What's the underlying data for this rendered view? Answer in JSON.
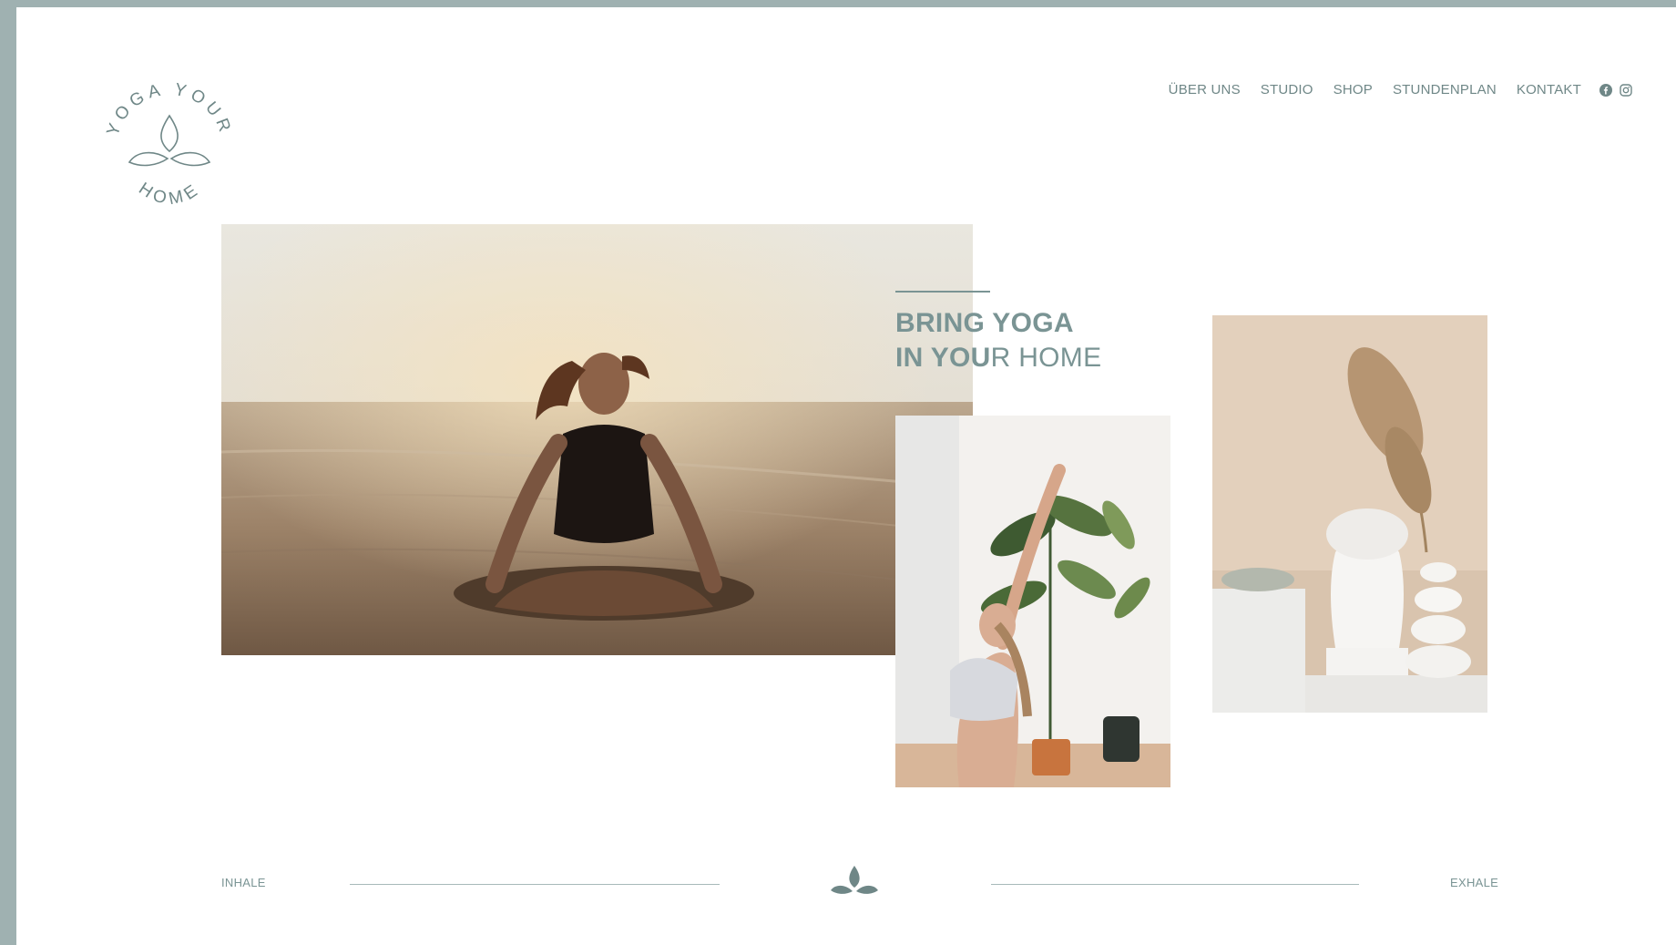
{
  "brand": {
    "logo_top": "YOGA YOUR",
    "logo_bottom": "HOME"
  },
  "nav": {
    "items": [
      "ÜBER UNS",
      "STUDIO",
      "SHOP",
      "STUNDENPLAN",
      "KONTAKT"
    ],
    "social": [
      "facebook-icon",
      "instagram-icon"
    ]
  },
  "hero": {
    "line1": "BRING YOGA",
    "line2_bold": "IN YOU",
    "line2_rest": "R HOME"
  },
  "footer": {
    "left_label": "INHALE",
    "right_label": "EXHALE"
  },
  "colors": {
    "frame": "#9fb1b1",
    "accent": "#7a9494",
    "background": "#ffffff"
  }
}
